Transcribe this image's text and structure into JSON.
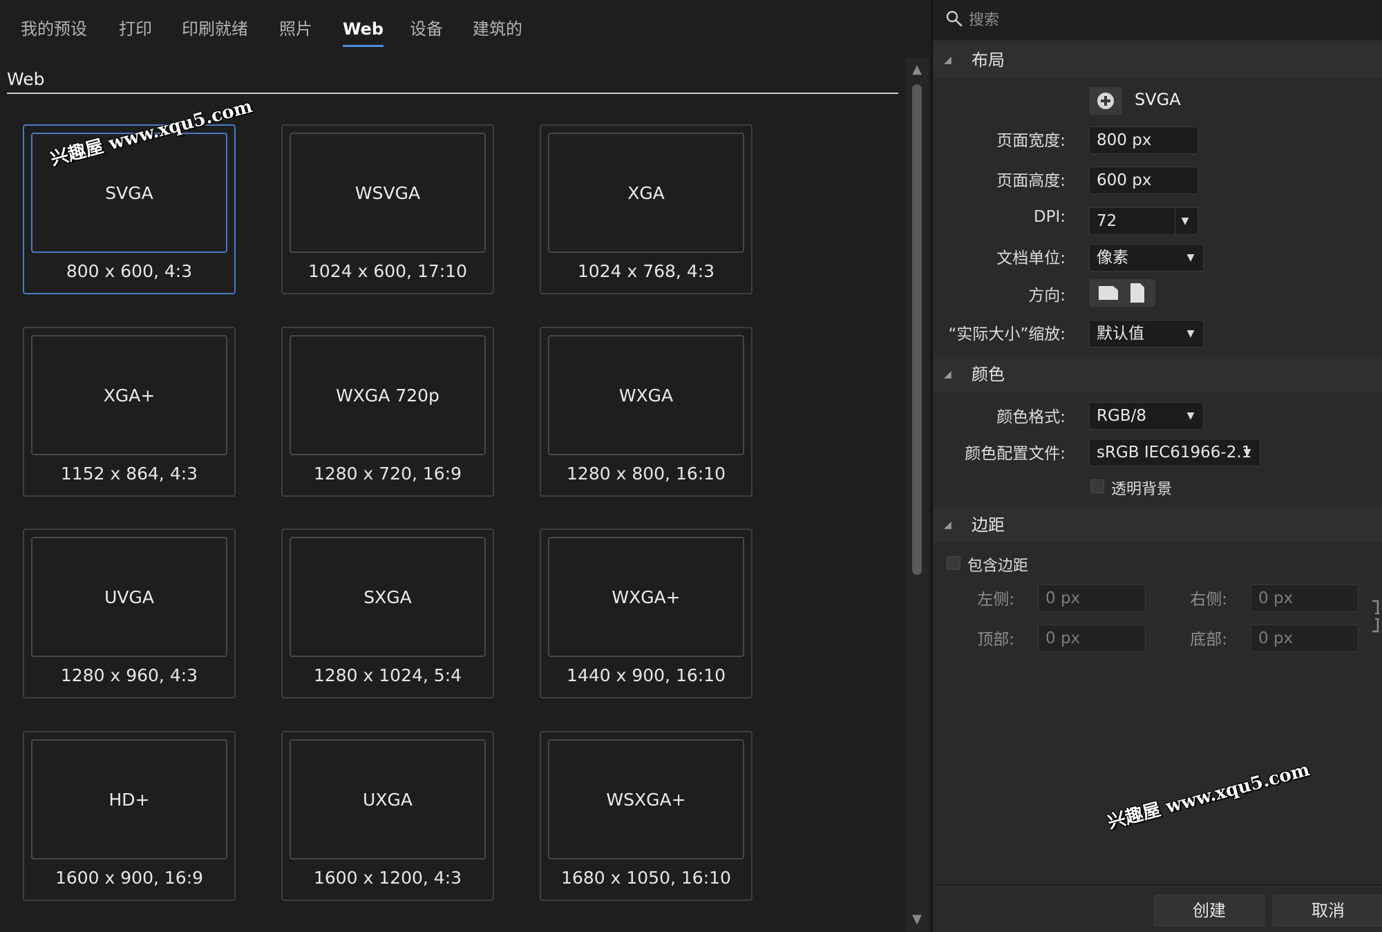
{
  "tabs": [
    {
      "label": "我的预设"
    },
    {
      "label": "打印"
    },
    {
      "label": "印刷就绪"
    },
    {
      "label": "照片"
    },
    {
      "label": "Web",
      "active": true
    },
    {
      "label": "设备"
    },
    {
      "label": "建筑的"
    }
  ],
  "section_title": "Web",
  "presets": [
    {
      "name": "SVGA",
      "size": "800 x 600, 4:3",
      "selected": true
    },
    {
      "name": "WSVGA",
      "size": "1024 x 600, 17:10"
    },
    {
      "name": "XGA",
      "size": "1024 x 768, 4:3"
    },
    {
      "name": "XGA+",
      "size": "1152 x 864, 4:3"
    },
    {
      "name": "WXGA 720p",
      "size": "1280 x 720, 16:9"
    },
    {
      "name": "WXGA",
      "size": "1280 x 800, 16:10"
    },
    {
      "name": "UVGA",
      "size": "1280 x 960, 4:3"
    },
    {
      "name": "SXGA",
      "size": "1280 x 1024, 5:4"
    },
    {
      "name": "WXGA+",
      "size": "1440 x 900, 16:10"
    },
    {
      "name": "HD+",
      "size": "1600 x 900, 16:9"
    },
    {
      "name": "UXGA",
      "size": "1600 x 1200, 4:3"
    },
    {
      "name": "WSXGA+",
      "size": "1680 x 1050, 16:10"
    }
  ],
  "search": {
    "placeholder": "搜索"
  },
  "layout": {
    "header": "布局",
    "preset_name": "SVGA",
    "page_width_label": "页面宽度:",
    "page_width": "800 px",
    "page_height_label": "页面高度:",
    "page_height": "600 px",
    "dpi_label": "DPI:",
    "dpi": "72",
    "units_label": "文档单位:",
    "units": "像素",
    "orientation_label": "方向:",
    "scale_label": "“实际大小”缩放:",
    "scale": "默认值"
  },
  "color": {
    "header": "颜色",
    "format_label": "颜色格式:",
    "format": "RGB/8",
    "profile_label": "颜色配置文件:",
    "profile": "sRGB IEC61966-2.1",
    "transparent_label": "透明背景",
    "transparent": false
  },
  "margins": {
    "header": "边距",
    "include_label": "包含边距",
    "include": false,
    "left_label": "左侧:",
    "left": "0 px",
    "right_label": "右侧:",
    "right": "0 px",
    "top_label": "顶部:",
    "top": "0 px",
    "bottom_label": "底部:",
    "bottom": "0 px"
  },
  "footer": {
    "create": "创建",
    "cancel": "取消"
  },
  "watermark": "兴趣屋 www.xqu5.com",
  "colors": {
    "accent": "#4a90e2",
    "selected_border": "#4b79c4"
  }
}
